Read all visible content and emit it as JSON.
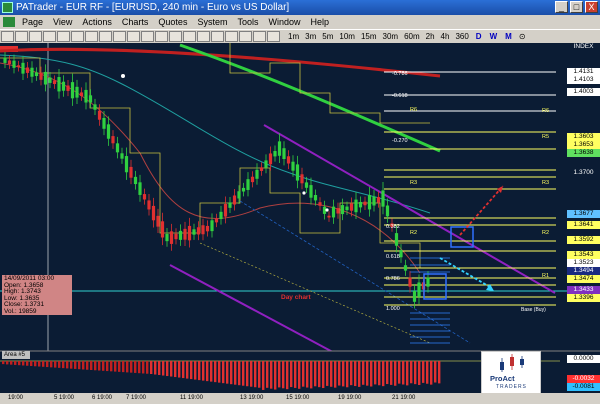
{
  "window": {
    "title": "PATrader - EUR RF - [EURUSD, 240 min - Euro vs US Dollar]",
    "min": "_",
    "max": "□",
    "close": "X"
  },
  "menu": [
    "Page",
    "View",
    "Actions",
    "Charts",
    "Quotes",
    "System",
    "Tools",
    "Window",
    "Help"
  ],
  "toolbar": {
    "timeframes": [
      "1m",
      "3m",
      "5m",
      "10m",
      "15m",
      "30m",
      "60m",
      "2h",
      "4h",
      "360"
    ],
    "periods": [
      "D",
      "W",
      "M"
    ]
  },
  "price_axis": {
    "top_label": "INDEX",
    "levels": [
      {
        "text": "1.4131",
        "bg": "#ffffff"
      },
      {
        "text": "1.4103",
        "bg": "#ffffff"
      },
      {
        "text": "1.4003",
        "bg": "#ffffff"
      },
      {
        "text": "1.3603",
        "bg": "#ffff60"
      },
      {
        "text": "1.3653",
        "bg": "#ffff60"
      },
      {
        "text": "1.3638",
        "bg": "#60e060"
      },
      {
        "text": "1.3677",
        "bg": "#60c0ff"
      },
      {
        "text": "1.3641",
        "bg": "#ffff60"
      },
      {
        "text": "1.3592",
        "bg": "#ffff60"
      },
      {
        "text": "1.3543",
        "bg": "#ffff60"
      },
      {
        "text": "1.3523",
        "bg": "#ffffff"
      },
      {
        "text": "1.3494",
        "bg": "#1a2a80"
      },
      {
        "text": "1.3474",
        "bg": "#ffff60"
      },
      {
        "text": "1.3433",
        "bg": "#8030c0"
      },
      {
        "text": "1.3396",
        "bg": "#ffff60"
      }
    ],
    "mid_ticks": [
      "1.3700"
    ],
    "indicator_ticks": [
      "0.0000",
      "-0.0032",
      "-0.0081"
    ]
  },
  "info": {
    "date": "14/09/2011 03:00",
    "open": "Open: 1.3658",
    "high": "High: 1.3743",
    "low": "Low: 1.3635",
    "close": "Close: 1.3731",
    "vol": "Vol.: 19859"
  },
  "fib_labels": [
    "-0.786",
    "-0.618",
    "-0.270",
    "0.382",
    "0.618",
    "0.786",
    "1.000"
  ],
  "pivot_labels": [
    "R6",
    "R5",
    "R4",
    "R3",
    "R2",
    "R1",
    "S1"
  ],
  "annotations": {
    "day_chart": "Day chart",
    "base_buy": "Base (Buy)"
  },
  "indicator": {
    "label": "Area #5"
  },
  "logo": {
    "brand": "ProAct",
    "sub": "TRADERS"
  },
  "time_axis": [
    "19:00",
    "5 19:00",
    "6 19:00",
    "7 19:00",
    "11 19:00",
    "13 19:00",
    "15 19:00",
    "19 19:00",
    "21 19:00"
  ],
  "colors": {
    "chart_bg": "#0b1c34",
    "up_candle": "#30d040",
    "down_candle": "#e03030",
    "fib_line": "#ffff60",
    "channel": "#9020c0"
  }
}
